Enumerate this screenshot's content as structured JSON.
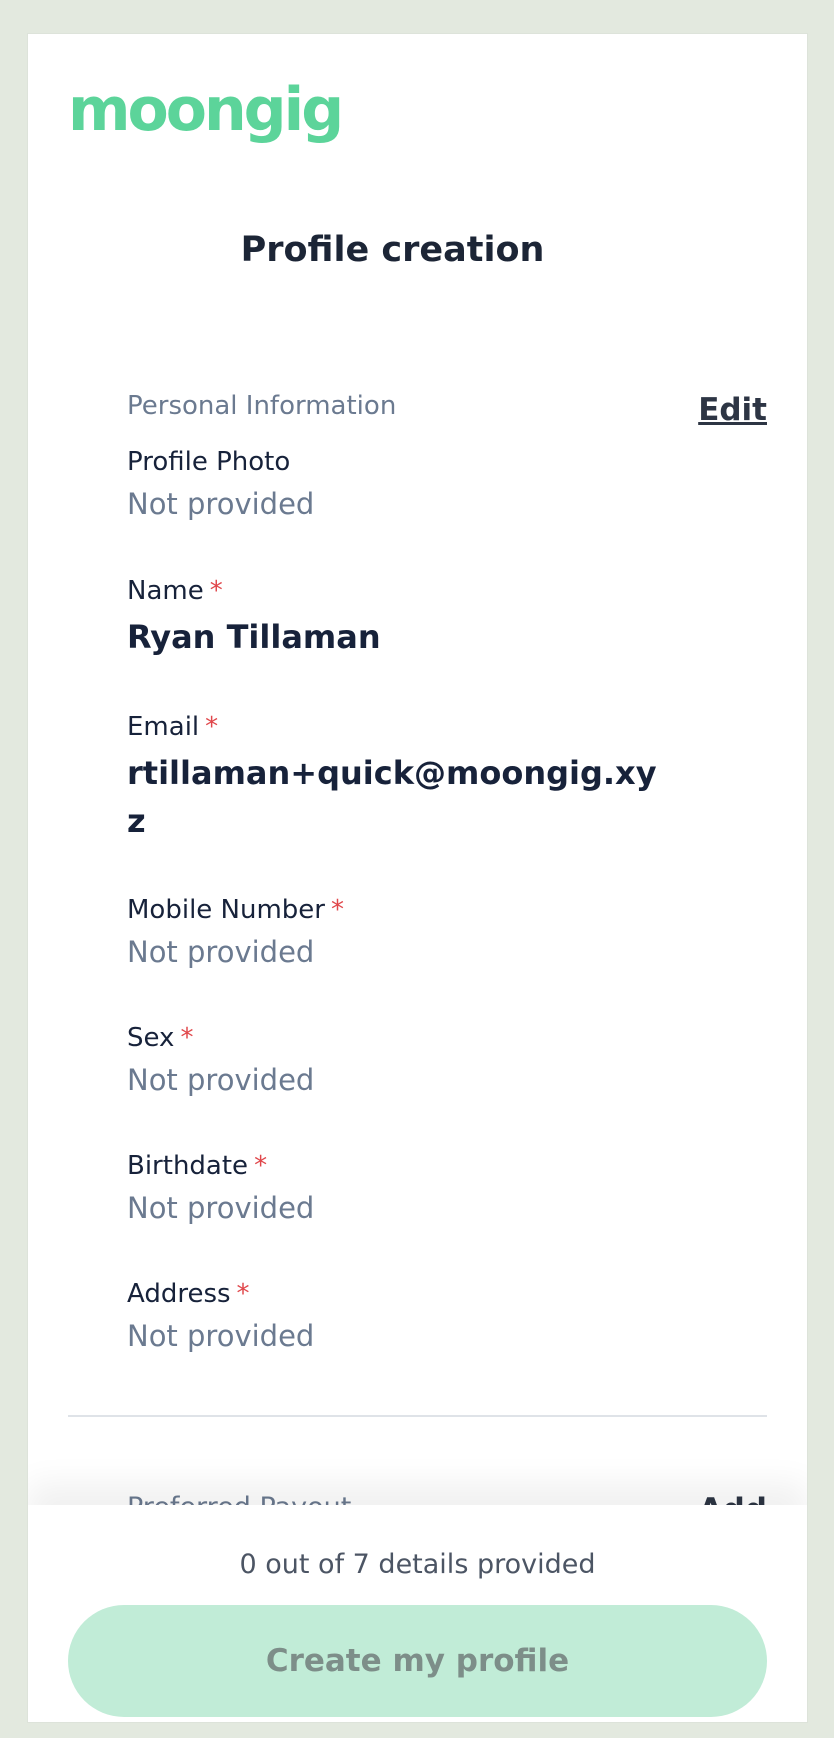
{
  "brand": {
    "logo_text": "moongig",
    "accent": "#5cd49a"
  },
  "page": {
    "title": "Profile creation"
  },
  "section": {
    "title": "Personal Information",
    "edit_label": "Edit"
  },
  "fields": [
    {
      "label": "Profile Photo",
      "required": false,
      "value": "Not provided",
      "provided": false
    },
    {
      "label": "Name",
      "required": true,
      "value": "Ryan Tillaman",
      "provided": true
    },
    {
      "label": "Email",
      "required": true,
      "value": "rtillaman+quick@moongig.xyz",
      "provided": true
    },
    {
      "label": "Mobile Number",
      "required": true,
      "value": "Not provided",
      "provided": false
    },
    {
      "label": "Sex",
      "required": true,
      "value": "Not provided",
      "provided": false
    },
    {
      "label": "Birthdate",
      "required": true,
      "value": "Not provided",
      "provided": false
    },
    {
      "label": "Address",
      "required": true,
      "value": "Not provided",
      "provided": false
    }
  ],
  "required_marker": "*",
  "next_section": {
    "title": "Preferred Payout",
    "action_label": "Add"
  },
  "footer": {
    "progress_text": "0 out of 7 details provided",
    "create_button_label": "Create my profile"
  }
}
